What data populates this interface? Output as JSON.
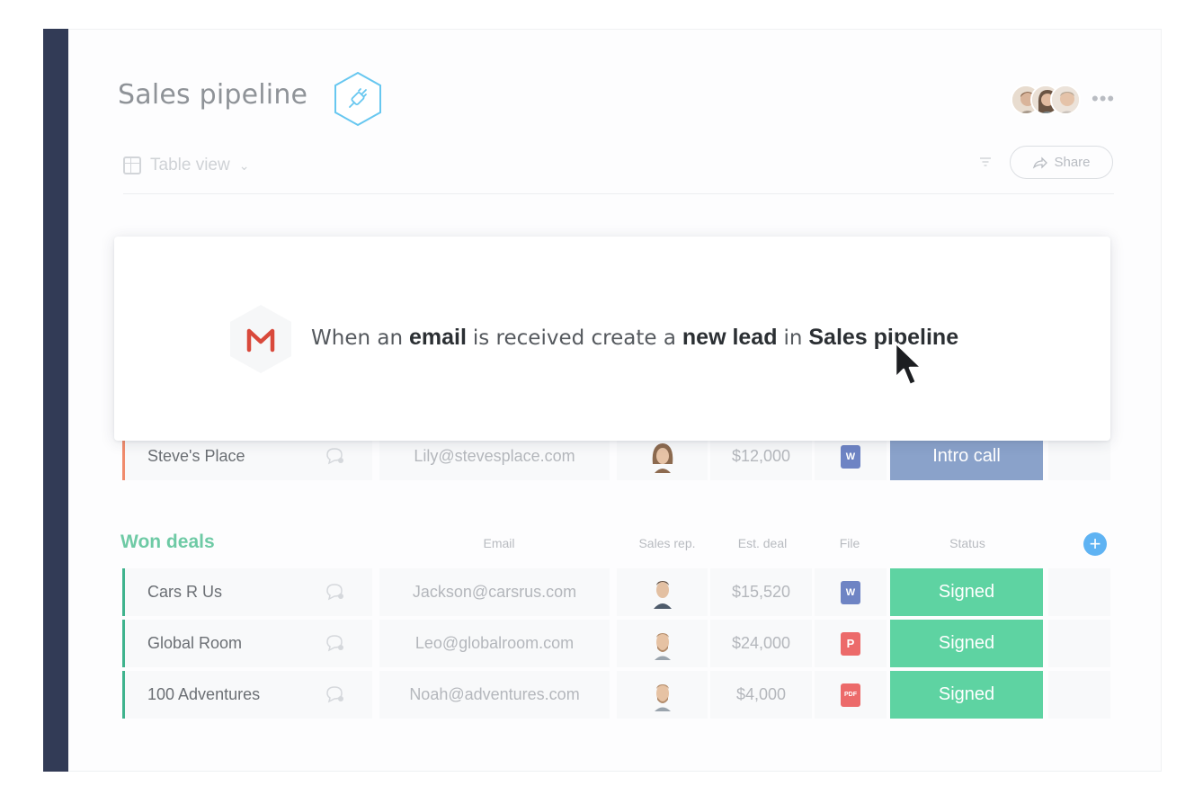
{
  "board": {
    "title": "Sales pipeline",
    "view_label": "Table view",
    "share_label": "Share",
    "more_label": "•••"
  },
  "automation": {
    "text_1": "When an",
    "bold_1": "email",
    "text_2": "is received create a",
    "bold_2": "new lead",
    "text_3": "in",
    "bold_3": "Sales pipeline"
  },
  "lead_row": {
    "name": "Steve's Place",
    "email": "Lily@stevesplace.com",
    "deal": "$12,000",
    "file": "W",
    "status": "Intro call"
  },
  "won_group": {
    "title": "Won deals",
    "columns": {
      "email": "Email",
      "sales_rep": "Sales rep.",
      "deal": "Est. deal",
      "file": "File",
      "status": "Status"
    },
    "add_label": "+",
    "rows": [
      {
        "name": "Cars R Us",
        "email": "Jackson@carsrus.com",
        "deal": "$15,520",
        "file": "W",
        "status": "Signed"
      },
      {
        "name": "Global Room",
        "email": "Leo@globalroom.com",
        "deal": "$24,000",
        "file": "P",
        "status": "Signed"
      },
      {
        "name": "100 Adventures",
        "email": "Noah@adventures.com",
        "deal": "$4,000",
        "file": "PDF",
        "status": "Signed"
      }
    ]
  },
  "colors": {
    "sidebar": "#323b56",
    "signed": "#5ed3a2",
    "intro_call": "#8aa2ca",
    "group_accent": "#3fb38d",
    "lead_accent": "#f08b6c",
    "add_button": "#5fb3f3"
  },
  "icons": [
    "table-view-icon",
    "chevron-down-icon",
    "filter-icon",
    "share-icon",
    "gmail-icon",
    "plug-icon",
    "chat-bubble-icon",
    "mouse-cursor-icon"
  ]
}
